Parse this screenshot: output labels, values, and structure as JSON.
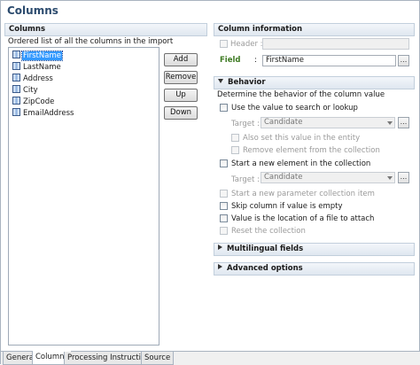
{
  "page": {
    "title": "Columns"
  },
  "columns_panel": {
    "header": "Columns",
    "description": "Ordered list of all the columns in the import",
    "items": [
      "FirstName",
      "LastName",
      "Address",
      "City",
      "ZipCode",
      "EmailAddress"
    ],
    "selected_index": 0,
    "buttons": {
      "add": "Add",
      "remove": "Remove",
      "up": "Up",
      "down": "Down"
    }
  },
  "column_info": {
    "header": "Column information",
    "header_label": "Header :",
    "header_value": "",
    "field_label": "Field",
    "field_colon": ":",
    "field_value": "FirstName"
  },
  "behavior": {
    "header": "Behavior",
    "description": "Determine the behavior of the column value",
    "use_value_label": "Use the value to search or lookup",
    "target1_label": "Target :",
    "target1_value": "Candidate",
    "also_set_label": "Also set this value in the entity",
    "remove_element_label": "Remove element from the collection",
    "start_new_label": "Start a new element in the collection",
    "target2_label": "Target :",
    "target2_value": "Candidate",
    "start_param_label": "Start a new parameter collection item",
    "skip_label": "Skip column if value is empty",
    "file_label": "Value is the location of a file to attach",
    "reset_label": "Reset the collection",
    "ellipsis": "..."
  },
  "multilingual": {
    "header": "Multilingual fields"
  },
  "advanced": {
    "header": "Advanced options"
  },
  "tabs": [
    "General",
    "Columns",
    "Processing Instructions",
    "Source"
  ],
  "active_tab": "Columns"
}
